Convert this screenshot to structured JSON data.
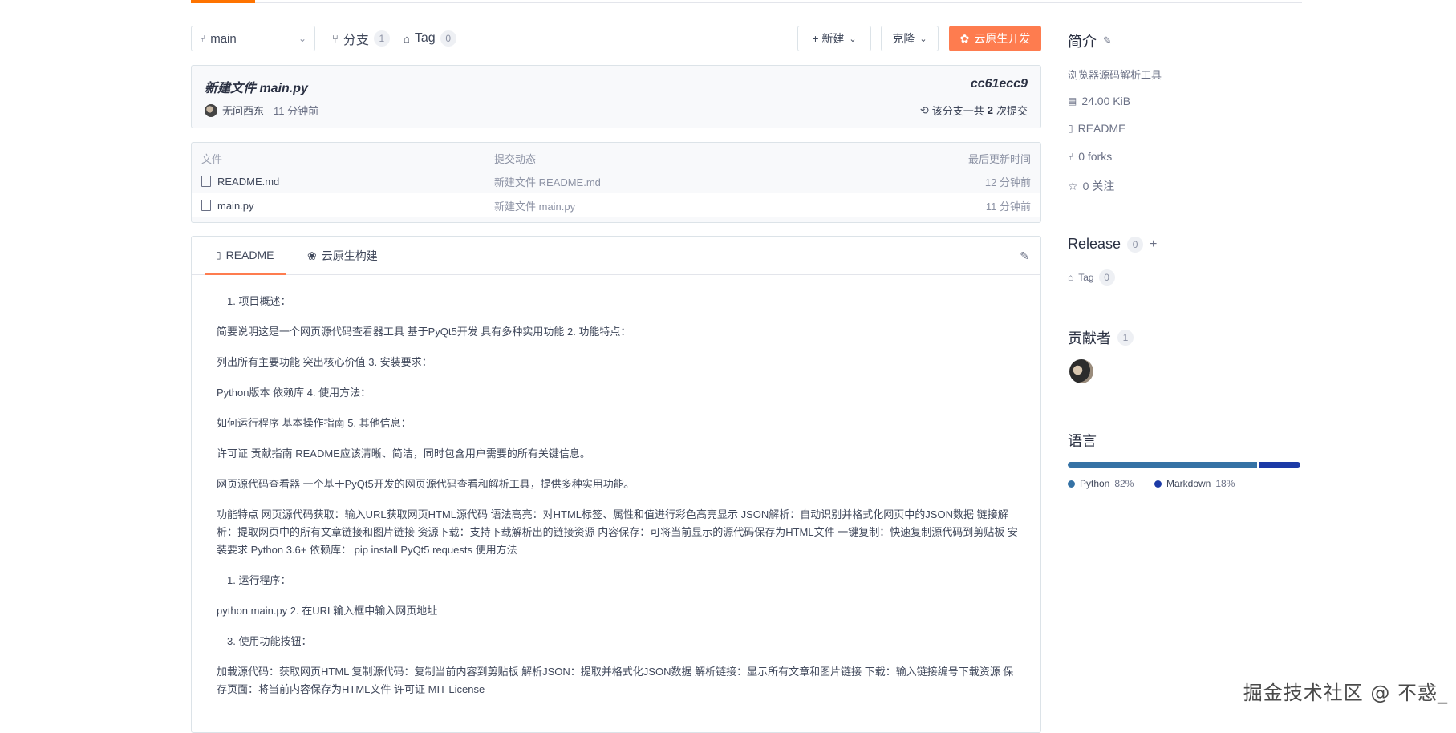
{
  "toolbar": {
    "branch": "main",
    "branches_label": "分支",
    "branches_count": "1",
    "tags_label": "Tag",
    "tags_count": "0",
    "new_label": "+ 新建",
    "clone_label": "克隆",
    "cloud_dev_label": "云原生开发"
  },
  "commit": {
    "title": "新建文件 main.py",
    "hash": "cc61ecc9",
    "author": "无问西东",
    "time": "11 分钟前",
    "count_prefix": "该分支一共",
    "count": "2",
    "count_suffix": "次提交"
  },
  "files": {
    "headers": [
      "文件",
      "提交动态",
      "最后更新时间"
    ],
    "rows": [
      {
        "name": "README.md",
        "message": "新建文件 README.md",
        "time": "12 分钟前"
      },
      {
        "name": "main.py",
        "message": "新建文件 main.py",
        "time": "11 分钟前"
      }
    ]
  },
  "readme": {
    "tab_readme": "README",
    "tab_cloud": "云原生构建",
    "paragraphs": [
      "1. 项目概述：",
      "简要说明这是一个网页源代码查看器工具 基于PyQt5开发 具有多种实用功能 2. 功能特点：",
      "列出所有主要功能 突出核心价值 3. 安装要求：",
      "Python版本 依赖库 4. 使用方法：",
      "如何运行程序 基本操作指南 5. 其他信息：",
      "许可证 贡献指南 README应该清晰、简洁，同时包含用户需要的所有关键信息。",
      "网页源代码查看器 一个基于PyQt5开发的网页源代码查看和解析工具，提供多种实用功能。",
      "功能特点 网页源代码获取：输入URL获取网页HTML源代码 语法高亮：对HTML标签、属性和值进行彩色高亮显示 JSON解析：自动识别并格式化网页中的JSON数据 链接解析：提取网页中的所有文章链接和图片链接 资源下载：支持下载解析出的链接资源 内容保存：可将当前显示的源代码保存为HTML文件 一键复制：快速复制源代码到剪贴板 安装要求 Python 3.6+ 依赖库： pip install PyQt5 requests 使用方法",
      "1. 运行程序：",
      "python main.py 2. 在URL输入框中输入网页地址",
      "3. 使用功能按钮：",
      "加载源代码：获取网页HTML 复制源代码：复制当前内容到剪贴板 解析JSON：提取并格式化JSON数据 解析链接：显示所有文章和图片链接 下载：输入链接编号下载资源 保存页面：将当前内容保存为HTML文件 许可证 MIT License"
    ]
  },
  "sidebar": {
    "intro_title": "简介",
    "description": "浏览器源码解析工具",
    "size": "24.00 KiB",
    "readme": "README",
    "forks": "0 forks",
    "watch": "0 关注",
    "release_title": "Release",
    "release_count": "0",
    "release_add": "+",
    "tag_label": "Tag",
    "tag_count": "0",
    "contributors_title": "贡献者",
    "contributors_count": "1",
    "languages_title": "语言",
    "languages": [
      {
        "name": "Python",
        "percent": "82%",
        "value": 82,
        "color": "#3572a5"
      },
      {
        "name": "Markdown",
        "percent": "18%",
        "value": 18,
        "color": "#1c3aa6"
      }
    ]
  },
  "watermark": "掘金技术社区 @ 不惑_"
}
